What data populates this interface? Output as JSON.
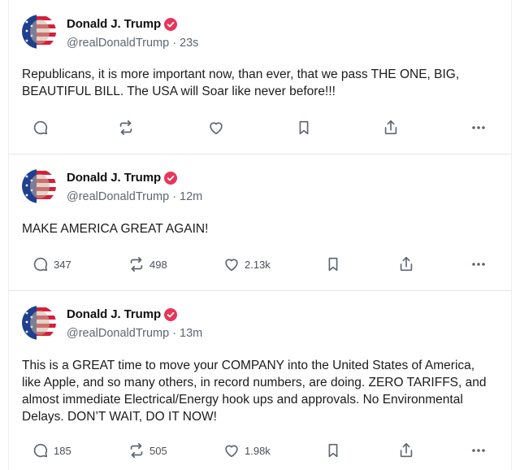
{
  "posts": [
    {
      "author": "Donald J. Trump",
      "handle": "@realDonaldTrump",
      "separator": "·",
      "time": "23s",
      "text": "Republicans, it is more important now, than ever, that we pass THE ONE, BIG, BEAUTIFUL BILL. The USA will Soar like never before!!!",
      "replies": "",
      "reposts": "",
      "likes": ""
    },
    {
      "author": "Donald J. Trump",
      "handle": "@realDonaldTrump",
      "separator": "·",
      "time": "12m",
      "text": "MAKE AMERICA GREAT AGAIN!",
      "replies": "347",
      "reposts": "498",
      "likes": "2.13k"
    },
    {
      "author": "Donald J. Trump",
      "handle": "@realDonaldTrump",
      "separator": "·",
      "time": "13m",
      "text": "This is a GREAT time to move your COMPANY into the United States of America, like Apple, and so many others, in record numbers, are doing. ZERO TARIFFS, and almost immediate Electrical/Energy hook ups and approvals. No Environmental Delays. DON’T WAIT, DO IT NOW!",
      "replies": "185",
      "reposts": "505",
      "likes": "1.98k"
    }
  ],
  "icons": {
    "reply": "reply-icon",
    "repost": "repost-icon",
    "like": "heart-icon",
    "bookmark": "bookmark-icon",
    "share": "share-icon",
    "more": "more-icon",
    "verified": "verified-badge-icon"
  },
  "colors": {
    "verified": "#e8355a",
    "icon": "#5d6672",
    "handle": "#5d6672"
  }
}
